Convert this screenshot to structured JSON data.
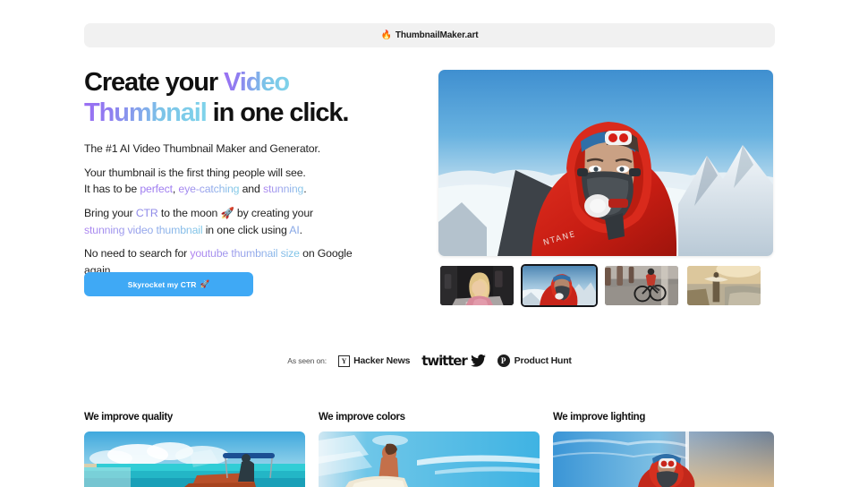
{
  "header": {
    "brand_icon": "flame-icon",
    "brand_name": "ThumbnailMaker.art"
  },
  "hero": {
    "headline": {
      "part1": "Create your ",
      "gradient1": "Video",
      "gradient2": "Thumbnail",
      "part2": " in one click."
    },
    "paragraphs": {
      "line1": "The #1 AI Video Thumbnail Maker and Generator.",
      "line2": "Your thumbnail is the first thing people will see.",
      "line3_pre": "It has to be ",
      "line3_a": "perfect",
      "line3_mid1": ", ",
      "line3_b": "eye-catching",
      "line3_mid2": " and ",
      "line3_c": "stunning",
      "line3_end": ".",
      "line4_pre": "Bring your ",
      "line4_ctr": "CTR",
      "line4_mid": " to the moon ",
      "line4_rocket": "🚀",
      "line4_post": " by creating your",
      "line5_a": "stunning video thumbnail",
      "line5_mid": " in one click using ",
      "line5_ai": "AI",
      "line5_end": ".",
      "line6_pre": "No need to search for ",
      "line6_kw": "youtube thumbnail size",
      "line6_post": " on Google",
      "line7": "again."
    },
    "cta": {
      "label": "Skyrocket my CTR",
      "icon": "rocket-icon"
    },
    "main_preview_alt": "mountaineer-with-oxygen-mask-on-snowy-summit",
    "thumbnails": [
      {
        "alt": "woman-in-pink-top-at-table",
        "selected": false
      },
      {
        "alt": "mountaineer-red-jacket-on-summit",
        "selected": true
      },
      {
        "alt": "cyclist-riding-on-pavement",
        "selected": false
      },
      {
        "alt": "surfer-holding-board-at-sunset",
        "selected": false
      }
    ]
  },
  "social_proof": {
    "label": "As seen on:",
    "logos": [
      {
        "mark": "Y",
        "name": "Hacker News"
      },
      {
        "mark": "bird-icon",
        "name": "twitter"
      },
      {
        "mark": "P",
        "name": "Product Hunt"
      }
    ]
  },
  "features": [
    {
      "title": "We improve quality",
      "alt": "tropical-beach-with-boat-before-after"
    },
    {
      "title": "We improve colors",
      "alt": "surfer-against-blue-sky-before-after"
    },
    {
      "title": "We improve lighting",
      "alt": "mountaineer-sky-before-after"
    }
  ],
  "colors": {
    "accent_blue": "#3fa9f5",
    "gradient_start": "#9b6ef3",
    "gradient_end": "#7fd4ea",
    "header_bg": "#f1f1f1",
    "text_dark": "#111111"
  }
}
